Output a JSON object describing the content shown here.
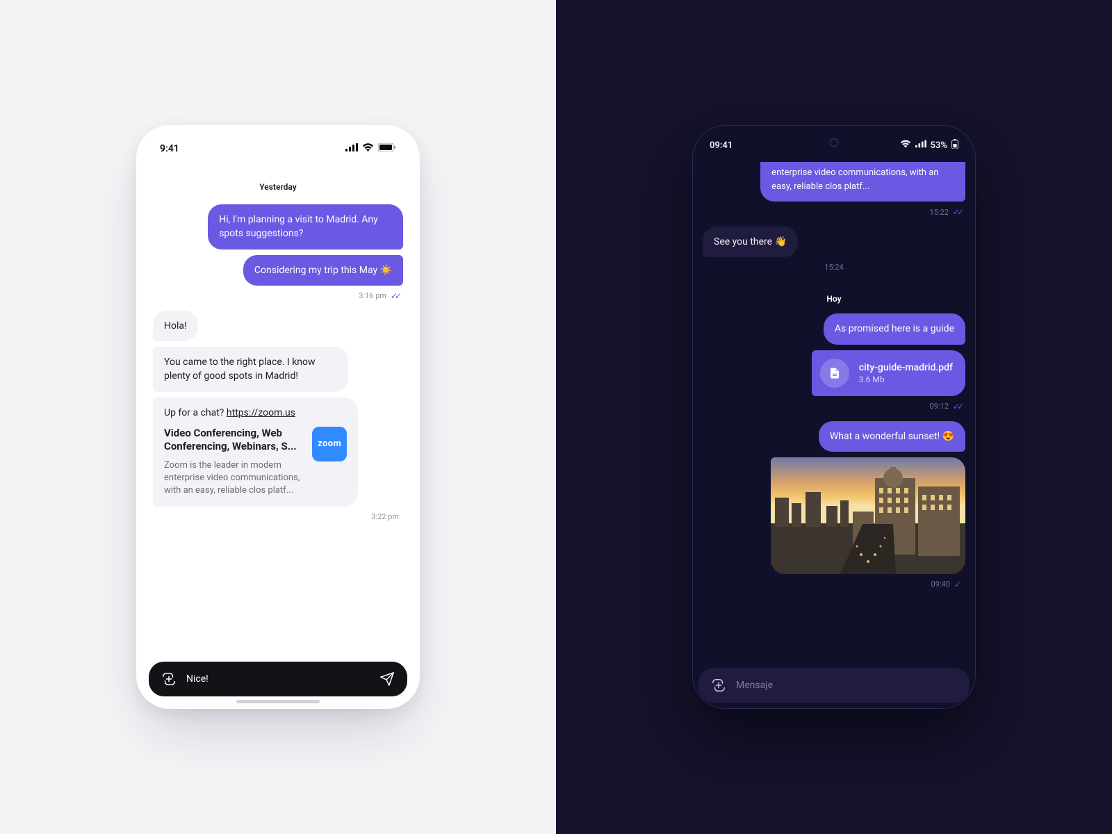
{
  "accent": "#6a59e3",
  "light": {
    "statusTime": "9:41",
    "divider": "Yesterday",
    "msgs": {
      "out1": "Hi, I'm planning a visit to Madrid. Any spots suggestions?",
      "out2": "Considering my trip this May ☀️",
      "outTime": "3:16 pm",
      "in1": "Hola!",
      "in2": "You came to the right place. I know plenty of good spots in Madrid!",
      "inTime": "3:22 pm"
    },
    "link": {
      "prompt": "Up for a chat? ",
      "url": "https://zoom.us",
      "title": "Video Conferencing, Web Conferencing, Webinars, S...",
      "desc": "Zoom is the leader in modern enterprise video communications, with an easy, reliable clos platf...",
      "thumbText": "zoom"
    },
    "input": {
      "value": "Nice!"
    }
  },
  "dark": {
    "statusTime": "09:41",
    "battery": "53%",
    "truncPreview": "enterprise video communications, with an easy, reliable clos platf...",
    "truncTime": "15:22",
    "in1": "See you there 👋",
    "in1Time": "15:24",
    "divider": "Hoy",
    "out1": "As promised here is a guide",
    "file": {
      "name": "city-guide-madrid.pdf",
      "size": "3.6 Mb"
    },
    "fileTime": "09:12",
    "out2": "What a wonderful sunset! 😍",
    "imgTime": "09:40",
    "input": {
      "placeholder": "Mensaje"
    }
  }
}
